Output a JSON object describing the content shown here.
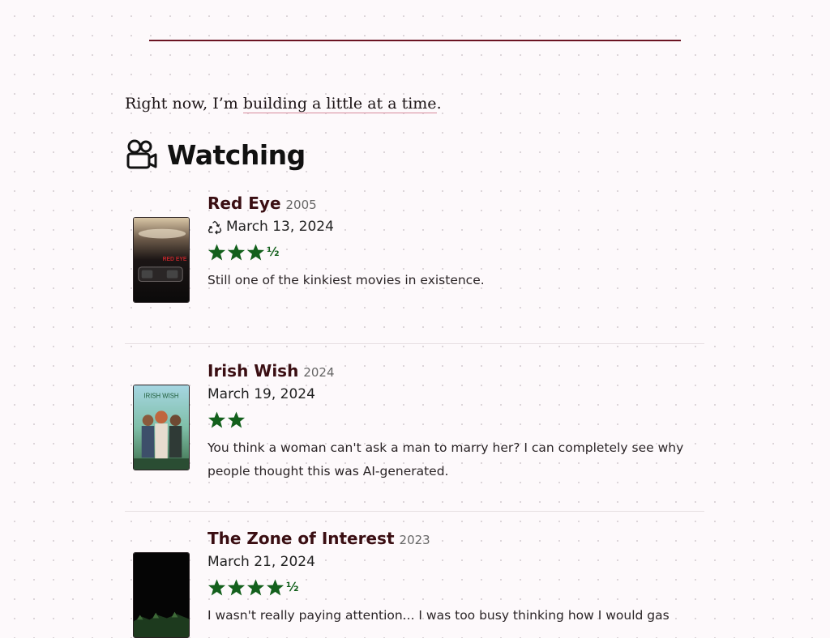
{
  "intro": {
    "prefix": "Right now, I’m ",
    "link": "building a little at a time",
    "suffix": "."
  },
  "section": {
    "title": "Watching",
    "icon": "movie-camera-icon"
  },
  "colors": {
    "accent": "#6b1422",
    "title": "#3a0e12",
    "star": "#13601c",
    "link_underline": "#d88a9c"
  },
  "entries": [
    {
      "title": "Red Eye",
      "year": "2005",
      "rewatch": true,
      "date": "March 13, 2024",
      "rating": 3.5,
      "half_label": "½",
      "review": "Still one of the kinkiest movies in existence.",
      "poster_text": "RED EYE"
    },
    {
      "title": "Irish Wish",
      "year": "2024",
      "rewatch": false,
      "date": "March 19, 2024",
      "rating": 2,
      "half_label": "",
      "review": "You think a woman can't ask a man to marry her? I can completely see why people thought this was AI-generated.",
      "poster_text": "IRISH WISH"
    },
    {
      "title": "The Zone of Interest",
      "year": "2023",
      "rewatch": false,
      "date": "March 21, 2024",
      "rating": 4.5,
      "half_label": "½",
      "review": "I wasn't really paying attention... I was too busy thinking how I would gas",
      "poster_text": ""
    }
  ]
}
